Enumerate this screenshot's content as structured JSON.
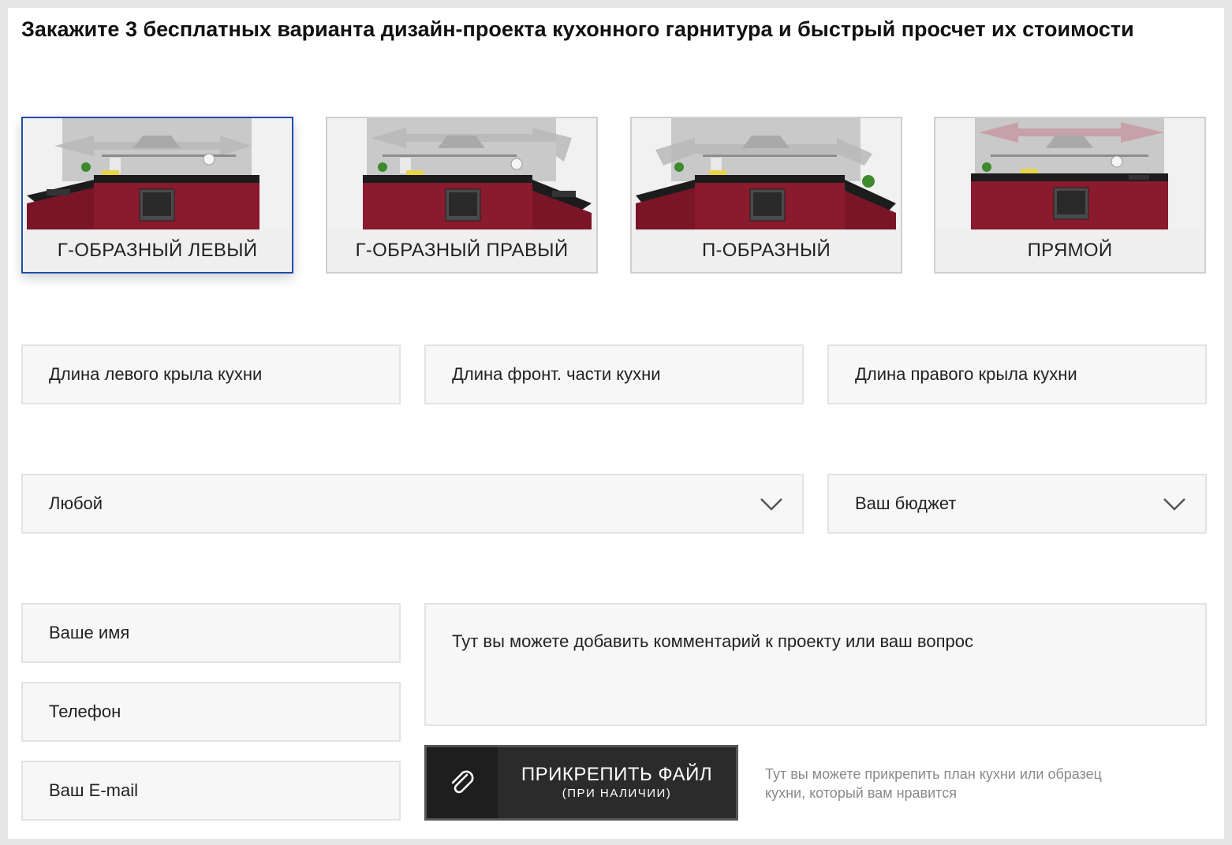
{
  "title": "Закажите 3 бесплатных варианта дизайн-проекта кухонного гарнитура и быстрый просчет их стоимости",
  "kitchen_types": [
    {
      "label": "Г-ОБРАЗНЫЙ ЛЕВЫЙ",
      "selected": true
    },
    {
      "label": "Г-ОБРАЗНЫЙ ПРАВЫЙ",
      "selected": false
    },
    {
      "label": "П-ОБРАЗНЫЙ",
      "selected": false
    },
    {
      "label": "ПРЯМОЙ",
      "selected": false
    }
  ],
  "dimensions": {
    "left_wing_placeholder": "Длина левого крыла кухни",
    "front_placeholder": "Длина фронт. части кухни",
    "right_wing_placeholder": "Длина правого крыла кухни"
  },
  "selects": {
    "style_value": "Любой",
    "budget_value": "Ваш бюджет",
    "chevron_icon": "chevron-down-icon"
  },
  "contact": {
    "name_placeholder": "Ваше имя",
    "phone_placeholder": "Телефон",
    "email_placeholder": "Ваш E-mail",
    "comment_placeholder": "Тут вы можете добавить комментарий к проекту или ваш вопрос"
  },
  "attach": {
    "label": "ПРИКРЕПИТЬ ФАЙЛ",
    "sublabel": "(ПРИ НАЛИЧИИ)",
    "icon": "paperclip-icon",
    "hint": "Тут вы можете прикрепить план кухни или образец кухни, который вам нравится"
  },
  "colors": {
    "selected_border": "#1f4fa8",
    "cabinet": "#8a1a2e",
    "countertop": "#1c1c1c",
    "button_bg": "#2b2b2b",
    "field_bg": "#f7f7f7"
  }
}
